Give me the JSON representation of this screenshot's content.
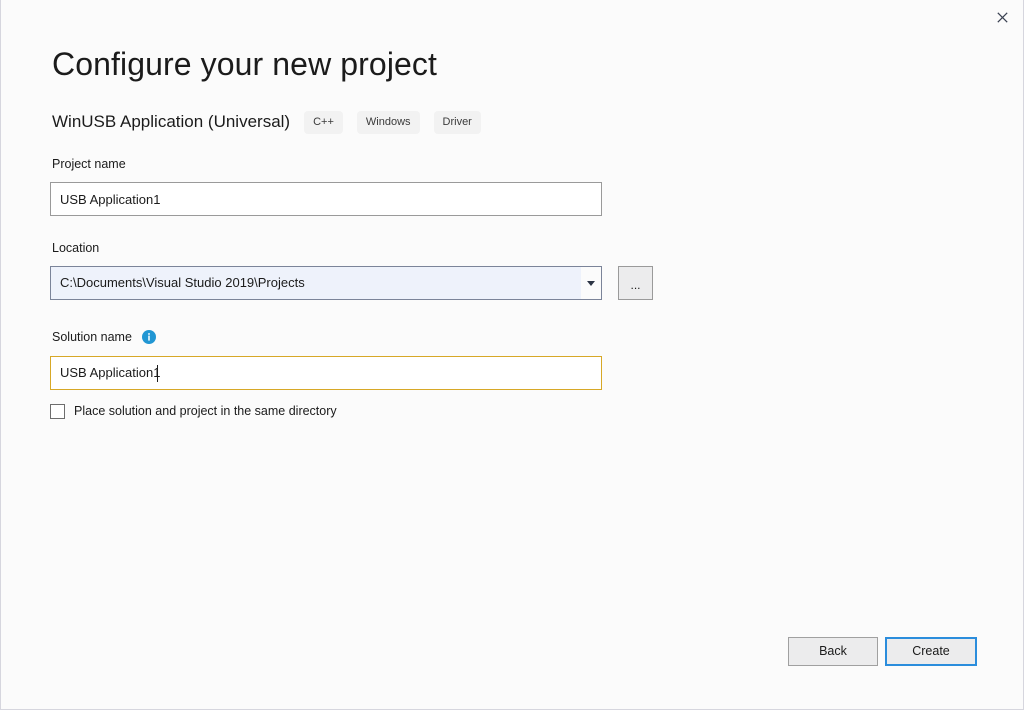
{
  "window": {
    "title": "Configure your new project",
    "close_icon": "close-icon"
  },
  "header": {
    "title": "Configure your new project",
    "template_name": "WinUSB Application (Universal)",
    "tags": [
      "C++",
      "Windows",
      "Driver"
    ]
  },
  "form": {
    "project_name": {
      "label": "Project name",
      "value": "USB Application1",
      "placeholder": ""
    },
    "location": {
      "label": "Location",
      "value": "C:\\Documents\\Visual Studio 2019\\Projects",
      "placeholder": "",
      "dropdown_icon": "chevron-down-icon",
      "browse_label": "..."
    },
    "solution_name": {
      "label": "Solution name",
      "value": "USB Application1",
      "placeholder": "",
      "info_icon": "info-icon",
      "focused": true
    },
    "same_directory": {
      "label": "Place solution and project in the same directory",
      "checked": false
    }
  },
  "footer": {
    "back_label": "Back",
    "create_label": "Create"
  },
  "colors": {
    "accent_blue": "#2b8ddc",
    "focus_gold": "#d7a827",
    "info_blue": "#2196d3",
    "combobox_fill": "#eef2fb",
    "page_background": "#fbfbfb"
  }
}
